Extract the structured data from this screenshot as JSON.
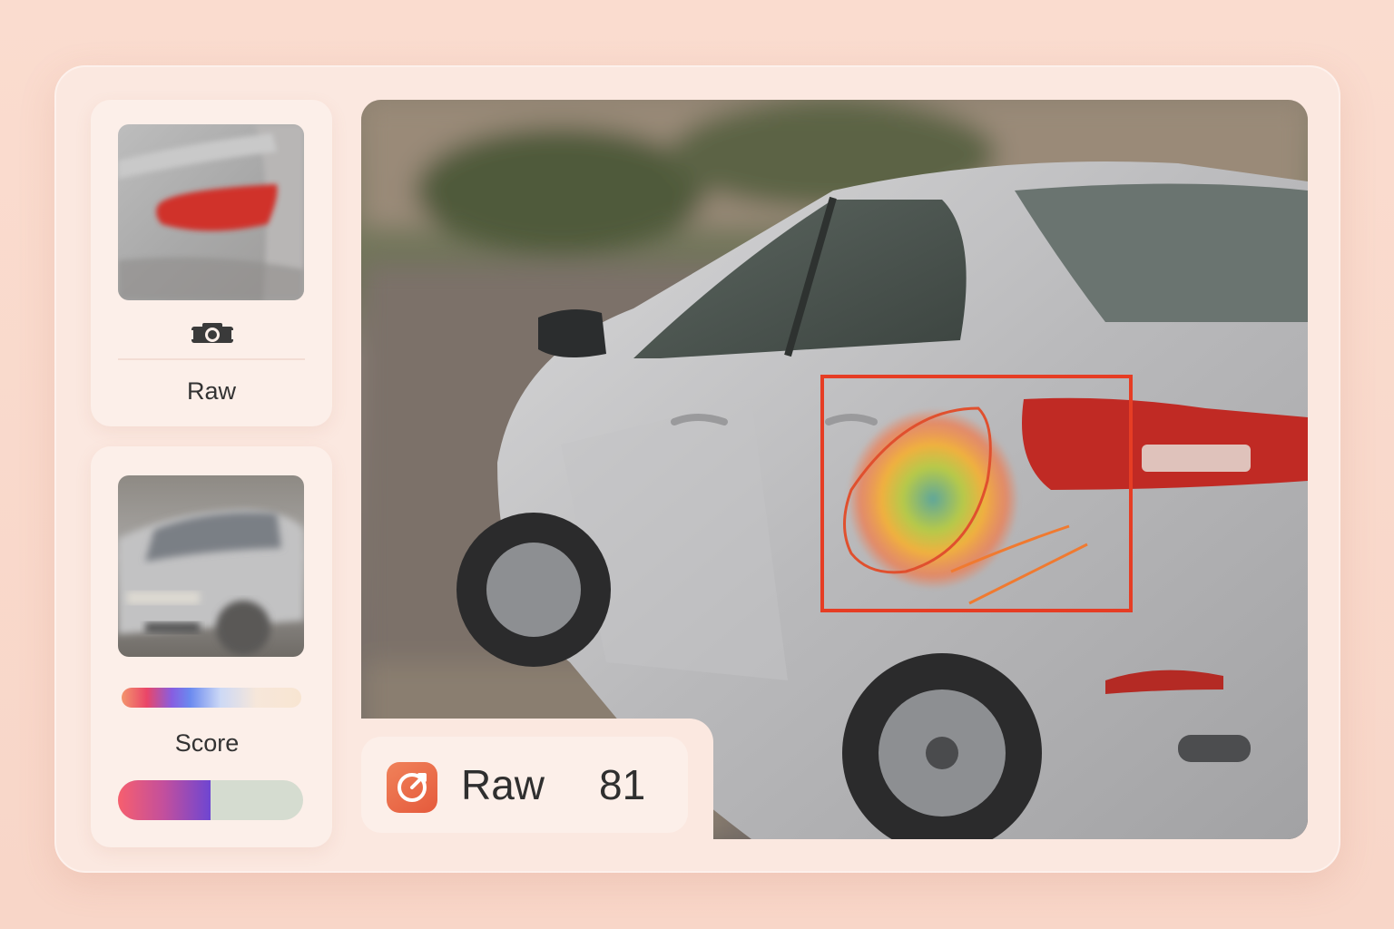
{
  "panels": {
    "raw": {
      "label": "Raw",
      "icon": "camera-icon"
    },
    "score": {
      "label": "Score",
      "score_fill": 0.5
    }
  },
  "result": {
    "label": "Raw",
    "value": "81",
    "icon": "target-icon"
  },
  "colors": {
    "accent": "#e85a3c",
    "highlight": "#e63d24",
    "background": "#f9d9cb"
  }
}
